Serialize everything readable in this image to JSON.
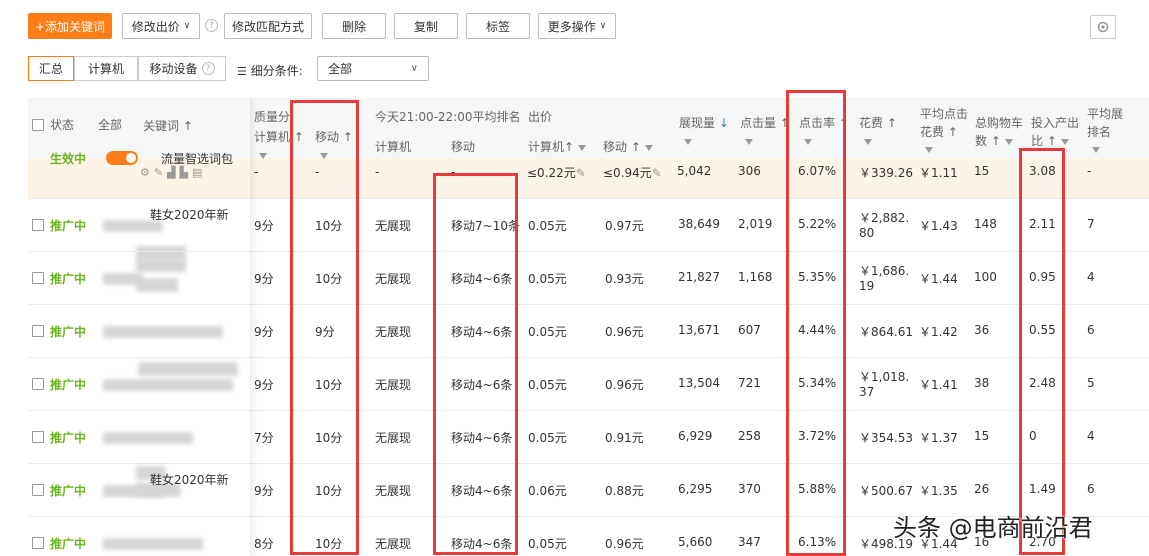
{
  "toolbar": {
    "add_keyword": "+添加关键词",
    "modify_bid": "修改出价",
    "modify_match": "修改匹配方式",
    "delete": "删除",
    "copy": "复制",
    "tag": "标签",
    "more": "更多操作"
  },
  "segments": [
    "汇总",
    "计算机",
    "移动设备"
  ],
  "filter": {
    "label": "细分条件:",
    "value": "全部"
  },
  "headers": {
    "status": "状态",
    "all": "全部",
    "keyword": "关键词",
    "quality": "质量分",
    "quality_pc": "计算机",
    "quality_mobile": "移动",
    "rank_title": "今天21:00-22:00平均排名",
    "rank_pc": "计算机",
    "rank_mobile": "移动",
    "bid": "出价",
    "bid_pc": "计算机",
    "bid_mobile": "移动",
    "impressions": "展现量",
    "clicks": "点击量",
    "ctr": "点击率",
    "cost": "花费",
    "avg_cpc_1": "平均点击",
    "avg_cpc_2": "花费",
    "cart_1": "总购物车",
    "cart_2": "数",
    "roi_1": "投入产出",
    "roi_2": "比",
    "avg_rank_1": "平均展",
    "avg_rank_2": "排名"
  },
  "first_row": {
    "status": "生效中",
    "keyword": "流量智选词包",
    "quality_pc": "-",
    "quality_mobile": "-",
    "rank_pc": "-",
    "rank_mobile": "-",
    "bid_pc": "≤0.22元",
    "bid_mobile": "≤0.94元",
    "impressions": "5,042",
    "clicks": "306",
    "ctr": "6.07%",
    "cost": "￥339.26",
    "avg_cpc": "￥1.11",
    "cart": "15",
    "roi": "3.08",
    "avg_rank": "-"
  },
  "rows": [
    {
      "status": "推广中",
      "keyword": "鞋女2020年新",
      "quality_pc": "9分",
      "quality_mobile": "10分",
      "rank_pc": "无展现",
      "rank_mobile": "移动7~10条",
      "bid_pc": "0.05元",
      "bid_mobile": "0.97元",
      "impressions": "38,649",
      "clicks": "2,019",
      "ctr": "5.22%",
      "cost_1": "￥2,882.",
      "cost_2": "80",
      "avg_cpc": "￥1.43",
      "cart": "148",
      "roi": "2.11",
      "avg_rank": "7"
    },
    {
      "status": "推广中",
      "keyword": "",
      "quality_pc": "9分",
      "quality_mobile": "10分",
      "rank_pc": "无展现",
      "rank_mobile": "移动4~6条",
      "bid_pc": "0.05元",
      "bid_mobile": "0.93元",
      "impressions": "21,827",
      "clicks": "1,168",
      "ctr": "5.35%",
      "cost_1": "￥1,686.",
      "cost_2": "19",
      "avg_cpc": "￥1.44",
      "cart": "100",
      "roi": "0.95",
      "avg_rank": "4"
    },
    {
      "status": "推广中",
      "keyword": "",
      "quality_pc": "9分",
      "quality_mobile": "9分",
      "rank_pc": "无展现",
      "rank_mobile": "移动4~6条",
      "bid_pc": "0.05元",
      "bid_mobile": "0.96元",
      "impressions": "13,671",
      "clicks": "607",
      "ctr": "4.44%",
      "cost_1": "￥864.61",
      "cost_2": "",
      "avg_cpc": "￥1.42",
      "cart": "36",
      "roi": "0.55",
      "avg_rank": "6"
    },
    {
      "status": "推广中",
      "keyword": "",
      "quality_pc": "9分",
      "quality_mobile": "10分",
      "rank_pc": "无展现",
      "rank_mobile": "移动4~6条",
      "bid_pc": "0.05元",
      "bid_mobile": "0.96元",
      "impressions": "13,504",
      "clicks": "721",
      "ctr": "5.34%",
      "cost_1": "￥1,018.",
      "cost_2": "37",
      "avg_cpc": "￥1.41",
      "cart": "38",
      "roi": "2.48",
      "avg_rank": "5"
    },
    {
      "status": "推广中",
      "keyword": "",
      "quality_pc": "7分",
      "quality_mobile": "10分",
      "rank_pc": "无展现",
      "rank_mobile": "移动4~6条",
      "bid_pc": "0.05元",
      "bid_mobile": "0.91元",
      "impressions": "6,929",
      "clicks": "258",
      "ctr": "3.72%",
      "cost_1": "￥354.53",
      "cost_2": "",
      "avg_cpc": "￥1.37",
      "cart": "15",
      "roi": "0",
      "avg_rank": "4"
    },
    {
      "status": "推广中",
      "keyword": "鞋女2020年新",
      "quality_pc": "9分",
      "quality_mobile": "10分",
      "rank_pc": "无展现",
      "rank_mobile": "移动4~6条",
      "bid_pc": "0.06元",
      "bid_mobile": "0.88元",
      "impressions": "6,295",
      "clicks": "370",
      "ctr": "5.88%",
      "cost_1": "￥500.67",
      "cost_2": "",
      "avg_cpc": "￥1.35",
      "cart": "26",
      "roi": "1.49",
      "avg_rank": "6"
    },
    {
      "status": "推广中",
      "keyword": "",
      "quality_pc": "8分",
      "quality_mobile": "10分",
      "rank_pc": "无展现",
      "rank_mobile": "移动4~6条",
      "bid_pc": "0.05元",
      "bid_mobile": "0.96元",
      "impressions": "5,660",
      "clicks": "347",
      "ctr": "6.13%",
      "cost_1": "￥498.19",
      "cost_2": "",
      "avg_cpc": "￥1.44",
      "cart": "16",
      "roi": "2.70",
      "avg_rank": ""
    }
  ],
  "watermark": "头条 @电商前沿君",
  "colors": {
    "accent": "#ff7d16",
    "status_green": "#6bb51d",
    "highlight_red": "#e83a3a",
    "first_row_bg": "#fdf3e7"
  }
}
